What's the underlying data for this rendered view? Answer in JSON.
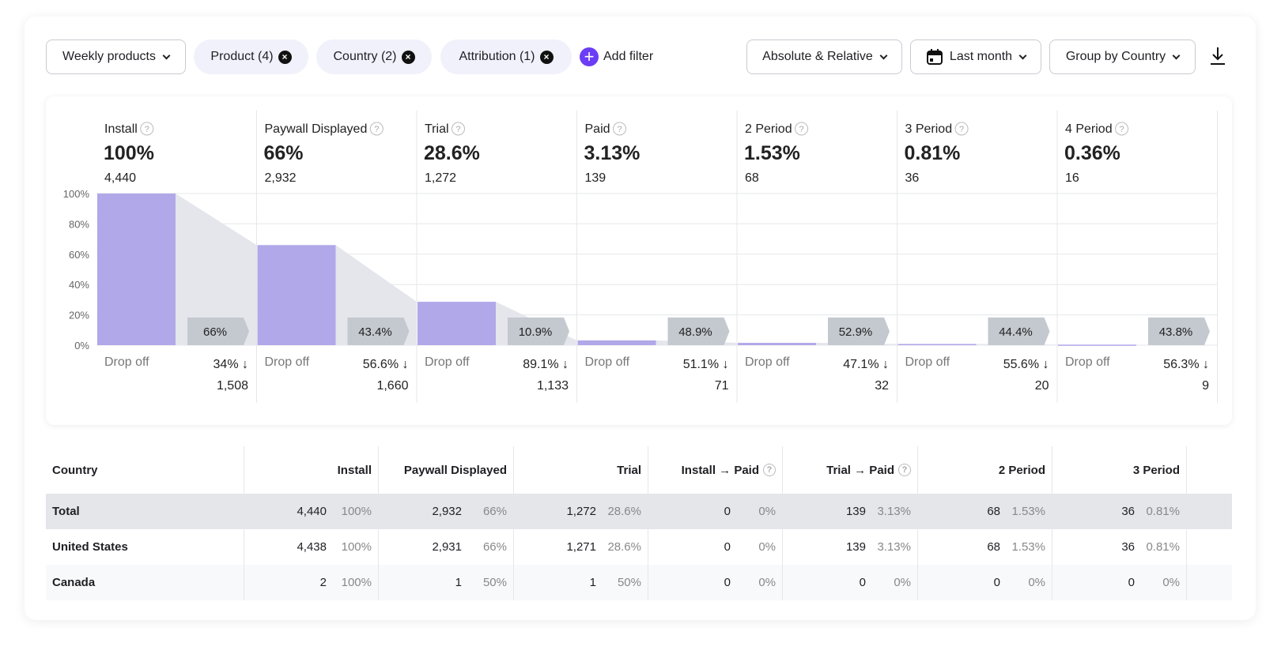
{
  "toolbar": {
    "report_select": "Weekly products",
    "filters": [
      {
        "label": "Product (4)"
      },
      {
        "label": "Country (2)"
      },
      {
        "label": "Attribution (1)"
      }
    ],
    "add_filter": "Add filter",
    "mode_select": "Absolute & Relative",
    "date_select": "Last month",
    "group_select": "Group by Country",
    "download_icon": "download-icon"
  },
  "colors": {
    "bar": "#b0a8e8",
    "funnel": "#e4e6ec",
    "badge": "#c4c8cf",
    "accent": "#6b3df5",
    "total_row": "#e4e6ea"
  },
  "chart_data": {
    "type": "bar",
    "ylim": [
      0,
      100
    ],
    "yticks": [
      "0%",
      "20%",
      "40%",
      "60%",
      "80%",
      "100%"
    ],
    "steps": [
      {
        "label": "Install",
        "pct": "100%",
        "value": 100,
        "count": "4,440",
        "conversion": "66%",
        "drop_label": "Drop off",
        "drop_pct": "34% ↓",
        "drop_count": "1,508"
      },
      {
        "label": "Paywall Displayed",
        "pct": "66%",
        "value": 66,
        "count": "2,932",
        "conversion": "43.4%",
        "drop_label": "Drop off",
        "drop_pct": "56.6% ↓",
        "drop_count": "1,660"
      },
      {
        "label": "Trial",
        "pct": "28.6%",
        "value": 28.6,
        "count": "1,272",
        "conversion": "10.9%",
        "drop_label": "Drop off",
        "drop_pct": "89.1% ↓",
        "drop_count": "1,133"
      },
      {
        "label": "Paid",
        "pct": "3.13%",
        "value": 3.13,
        "count": "139",
        "conversion": "48.9%",
        "drop_label": "Drop off",
        "drop_pct": "51.1% ↓",
        "drop_count": "71"
      },
      {
        "label": "2 Period",
        "pct": "1.53%",
        "value": 1.53,
        "count": "68",
        "conversion": "52.9%",
        "drop_label": "Drop off",
        "drop_pct": "47.1% ↓",
        "drop_count": "32"
      },
      {
        "label": "3 Period",
        "pct": "0.81%",
        "value": 0.81,
        "count": "36",
        "conversion": "44.4%",
        "drop_label": "Drop off",
        "drop_pct": "55.6% ↓",
        "drop_count": "20"
      },
      {
        "label": "4 Period",
        "pct": "0.36%",
        "value": 0.36,
        "count": "16",
        "conversion": "43.8%",
        "drop_label": "Drop off",
        "drop_pct": "56.3% ↓",
        "drop_count": "9"
      }
    ]
  },
  "table": {
    "headers": [
      "Country",
      "Install",
      "Paywall Displayed",
      "Trial",
      "Install → Paid",
      "Trial → Paid",
      "2 Period",
      "3 Period"
    ],
    "rows": [
      {
        "name": "Total",
        "cells": [
          [
            "4,440",
            "100%"
          ],
          [
            "2,932",
            "66%"
          ],
          [
            "1,272",
            "28.6%"
          ],
          [
            "0",
            "0%"
          ],
          [
            "139",
            "3.13%"
          ],
          [
            "68",
            "1.53%"
          ],
          [
            "36",
            "0.81%"
          ]
        ]
      },
      {
        "name": "United States",
        "cells": [
          [
            "4,438",
            "100%"
          ],
          [
            "2,931",
            "66%"
          ],
          [
            "1,271",
            "28.6%"
          ],
          [
            "0",
            "0%"
          ],
          [
            "139",
            "3.13%"
          ],
          [
            "68",
            "1.53%"
          ],
          [
            "36",
            "0.81%"
          ]
        ]
      },
      {
        "name": "Canada",
        "cells": [
          [
            "2",
            "100%"
          ],
          [
            "1",
            "50%"
          ],
          [
            "1",
            "50%"
          ],
          [
            "0",
            "0%"
          ],
          [
            "0",
            "0%"
          ],
          [
            "0",
            "0%"
          ],
          [
            "0",
            "0%"
          ]
        ]
      }
    ]
  }
}
